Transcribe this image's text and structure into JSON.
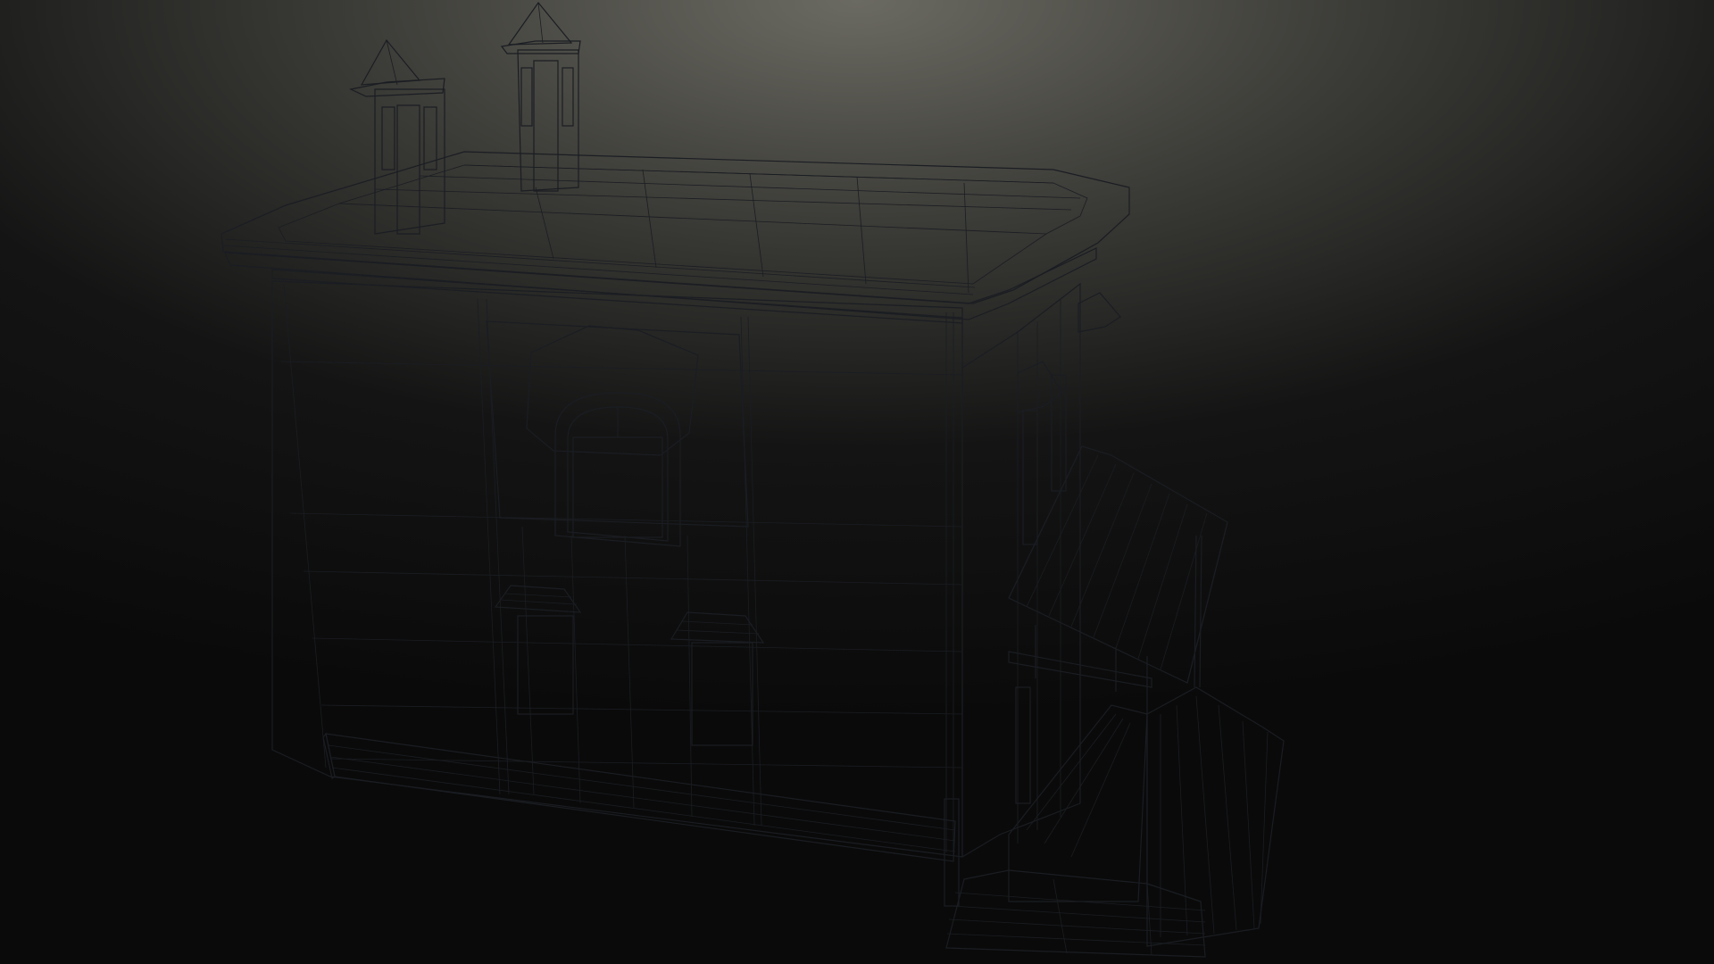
{
  "viewport": {
    "background_top": "#6b6a62",
    "background_bottom": "#0a0a0a",
    "wire_color": "#1a1d22",
    "front_wall_color": "#b5bcc6",
    "side_wall_color": "#9ea6b1",
    "roof_color": "#d8dadc"
  },
  "model": {
    "subject": "two-storey-house-wireframe",
    "shading": "clay-with-wireframe-overlay"
  }
}
